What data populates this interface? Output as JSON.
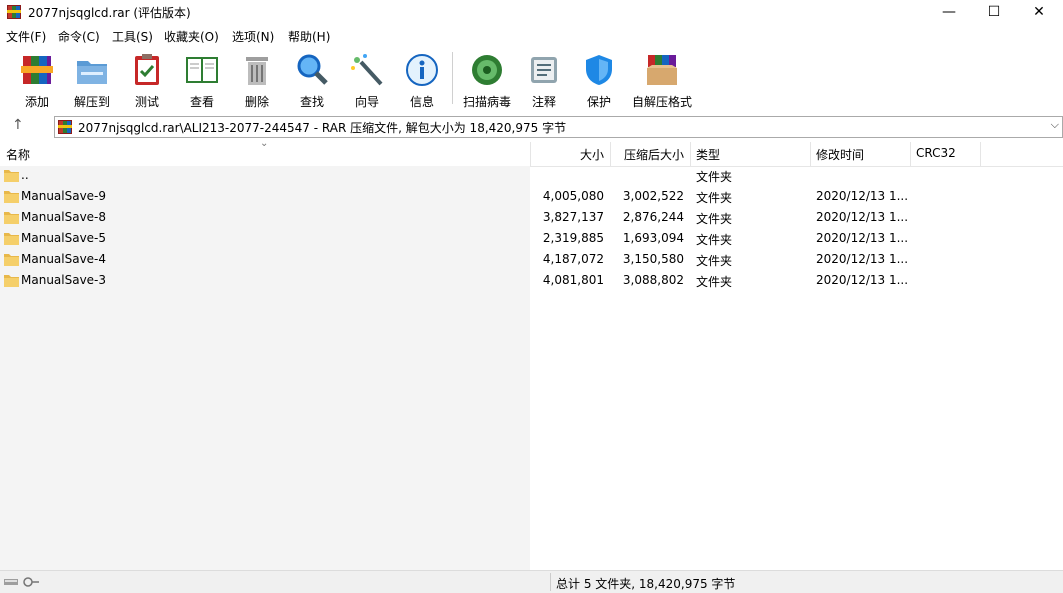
{
  "window": {
    "title": "2077njsqglcd.rar (评估版本)",
    "minimize": "—",
    "maximize": "☐",
    "close": "✕"
  },
  "menu": [
    "文件(F)",
    "命令(C)",
    "工具(S)",
    "收藏夹(O)",
    "选项(N)",
    "帮助(H)"
  ],
  "toolbar": [
    {
      "label": "添加",
      "icon": "add-archive-icon"
    },
    {
      "label": "解压到",
      "icon": "extract-folder-icon"
    },
    {
      "label": "测试",
      "icon": "test-clipboard-icon"
    },
    {
      "label": "查看",
      "icon": "view-book-icon"
    },
    {
      "label": "删除",
      "icon": "trash-icon"
    },
    {
      "label": "查找",
      "icon": "magnifier-icon"
    },
    {
      "label": "向导",
      "icon": "wizard-wand-icon"
    },
    {
      "label": "信息",
      "icon": "info-icon"
    },
    {
      "label": "扫描病毒",
      "icon": "virus-scan-icon"
    },
    {
      "label": "注释",
      "icon": "comment-icon"
    },
    {
      "label": "保护",
      "icon": "shield-icon"
    },
    {
      "label": "自解压格式",
      "icon": "sfx-box-icon"
    }
  ],
  "address": {
    "up": "↑",
    "path": "2077njsqglcd.rar\\ALI213-2077-244547 - RAR 压缩文件, 解包大小为 18,420,975 字节",
    "dropdown": "⌵"
  },
  "columns": {
    "name": "名称",
    "size": "大小",
    "packed": "压缩后大小",
    "type": "类型",
    "modified": "修改时间",
    "crc": "CRC32",
    "sort_indicator": "⌄"
  },
  "rows": [
    {
      "name": "..",
      "size": "",
      "packed": "",
      "type": "文件夹",
      "modified": "",
      "crc": ""
    },
    {
      "name": "ManualSave-9",
      "size": "4,005,080",
      "packed": "3,002,522",
      "type": "文件夹",
      "modified": "2020/12/13 1...",
      "crc": ""
    },
    {
      "name": "ManualSave-8",
      "size": "3,827,137",
      "packed": "2,876,244",
      "type": "文件夹",
      "modified": "2020/12/13 1...",
      "crc": ""
    },
    {
      "name": "ManualSave-5",
      "size": "2,319,885",
      "packed": "1,693,094",
      "type": "文件夹",
      "modified": "2020/12/13 1...",
      "crc": ""
    },
    {
      "name": "ManualSave-4",
      "size": "4,187,072",
      "packed": "3,150,580",
      "type": "文件夹",
      "modified": "2020/12/13 1...",
      "crc": ""
    },
    {
      "name": "ManualSave-3",
      "size": "4,081,801",
      "packed": "3,088,802",
      "type": "文件夹",
      "modified": "2020/12/13 1...",
      "crc": ""
    }
  ],
  "status": {
    "text": "总计 5 文件夹, 18,420,975 字节"
  }
}
